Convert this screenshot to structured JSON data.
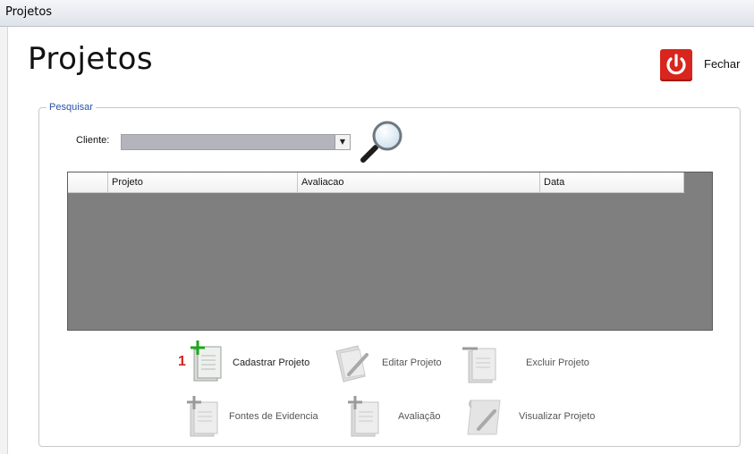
{
  "window": {
    "title": "Projetos"
  },
  "page": {
    "title": "Projetos"
  },
  "close_button": {
    "label": "Fechar",
    "icon": "power-icon",
    "color": "#d8251d"
  },
  "search_group": {
    "legend": "Pesquisar",
    "cliente_label": "Cliente:",
    "cliente_value": "",
    "search_icon": "magnifier-icon"
  },
  "grid": {
    "columns": [
      "Projeto",
      "Avaliacao",
      "Data"
    ],
    "rows": []
  },
  "actions": {
    "badge": "1",
    "cadastrar": "Cadastrar Projeto",
    "editar": "Editar Projeto",
    "excluir": "Excluir Projeto",
    "fontes": "Fontes de Evidencia",
    "avaliacao": "Avaliação",
    "visualizar": "Visualizar Projeto"
  }
}
